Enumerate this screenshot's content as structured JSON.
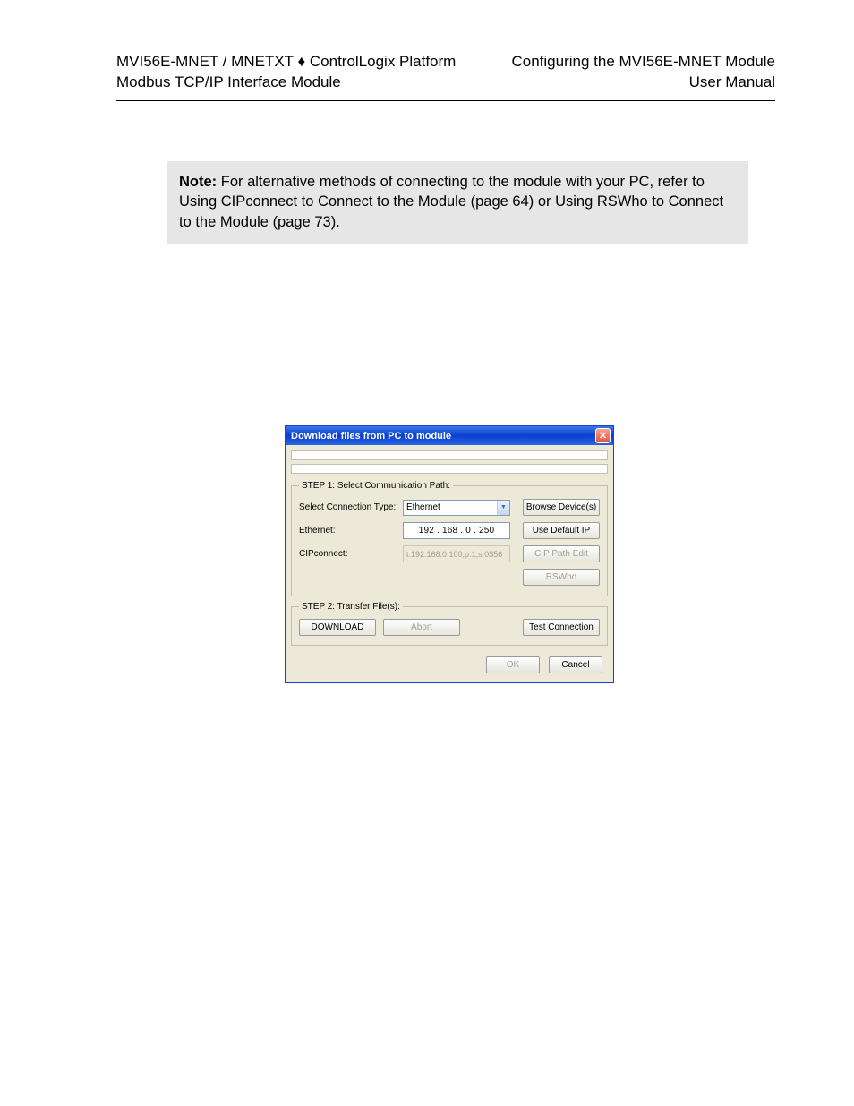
{
  "header": {
    "left_line1_a": "MVI56E-MNET / MNETXT ",
    "left_line1_b": " ControlLogix Platform",
    "left_line2": "Modbus TCP/IP Interface Module",
    "right_line1": "Configuring the MVI56E-MNET Module",
    "right_line2": "User Manual",
    "diamond": "♦"
  },
  "note": {
    "label": "Note:",
    "text": " For alternative methods of connecting to the module with your PC, refer to Using CIPconnect to Connect to the Module (page 64) or Using RSWho to Connect to the Module (page 73)."
  },
  "dialog": {
    "title": "Download files from PC to module",
    "close": "✕",
    "step1": {
      "legend": "STEP 1: Select Communication Path:",
      "conn_type_label": "Select Connection Type:",
      "conn_type_value": "Ethernet",
      "browse_btn": "Browse Device(s)",
      "ethernet_label": "Ethernet:",
      "ip": {
        "a": "192",
        "b": "168",
        "c": "0",
        "d": "250"
      },
      "use_default_btn": "Use Default IP",
      "cip_label": "CIPconnect:",
      "cip_value": "t:192.168.0.100,p:1,s:0$56",
      "cip_path_btn": "CIP Path Edit",
      "rswho_btn": "RSWho"
    },
    "step2": {
      "legend": "STEP 2: Transfer File(s):",
      "download_btn": "DOWNLOAD",
      "abort_btn": "Abort",
      "test_btn": "Test Connection"
    },
    "footer": {
      "ok": "OK",
      "cancel": "Cancel"
    }
  }
}
